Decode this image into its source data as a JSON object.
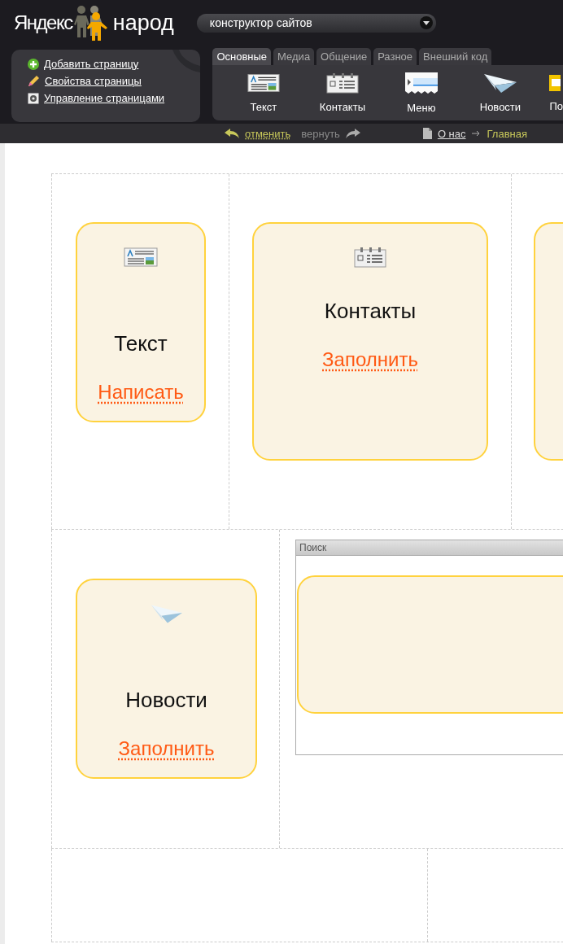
{
  "logo": {
    "left": "Яндекс",
    "right": "народ"
  },
  "mode_select": {
    "value": "конструктор сайтов"
  },
  "page_actions": [
    {
      "label": "Добавить страницу"
    },
    {
      "label": "Свойства страницы"
    },
    {
      "label": "Управление страницами"
    }
  ],
  "tabs": [
    {
      "label": "Основные",
      "selected": true
    },
    {
      "label": "Медиа",
      "selected": false
    },
    {
      "label": "Общение",
      "selected": false
    },
    {
      "label": "Разное",
      "selected": false
    },
    {
      "label": "Внешний код",
      "selected": false
    }
  ],
  "tools": [
    {
      "kind": "text",
      "label": "Текст"
    },
    {
      "kind": "contacts",
      "label": "Контакты"
    },
    {
      "kind": "menu",
      "label": "Меню"
    },
    {
      "kind": "news",
      "label": "Новости"
    },
    {
      "kind": "poll",
      "label": "По"
    }
  ],
  "history": {
    "undo": "отменить",
    "redo": "вернуть"
  },
  "breadcrumb": {
    "current": "О нас",
    "target": "Главная"
  },
  "layout_rows": [
    {
      "cells": [
        {
          "widget": {
            "kind": "text",
            "title": "Текст",
            "action": "Написать"
          }
        },
        {
          "widget": {
            "kind": "contacts",
            "title": "Контакты",
            "action": "Заполнить"
          }
        },
        {
          "widget": {
            "kind": "blank"
          }
        }
      ]
    },
    {
      "cells": [
        {
          "widget": {
            "kind": "news",
            "title": "Новости",
            "action": "Заполнить"
          }
        },
        {
          "widget": {
            "kind": "panel",
            "title": "Поиск"
          }
        }
      ]
    },
    {
      "cells": [
        {},
        {}
      ]
    }
  ]
}
